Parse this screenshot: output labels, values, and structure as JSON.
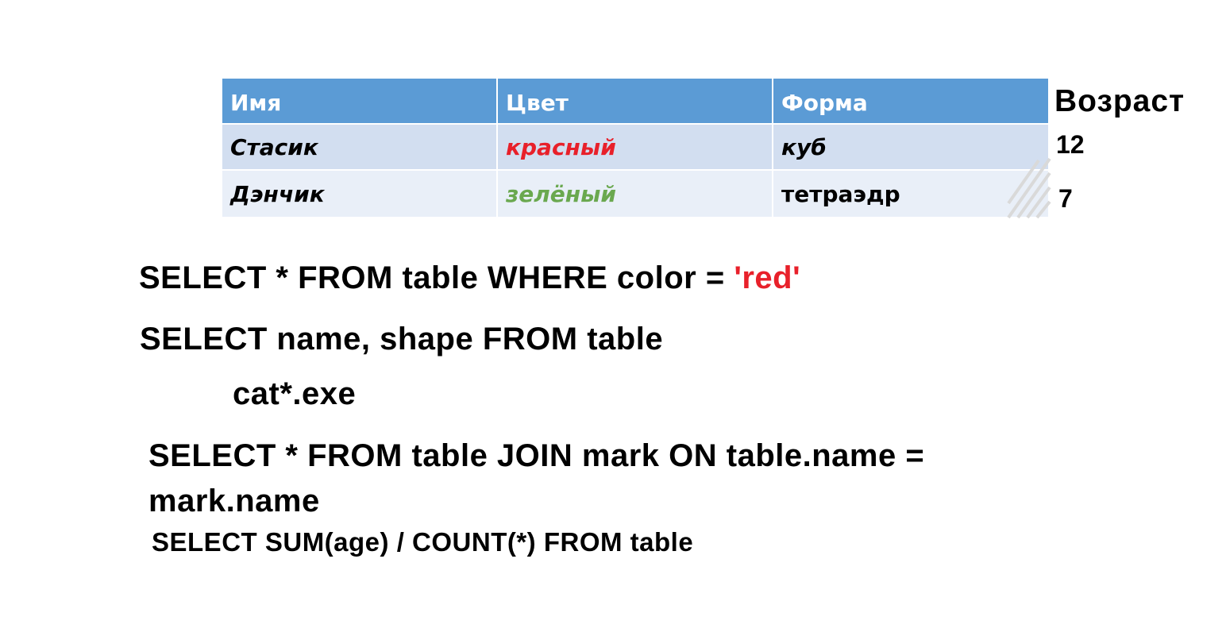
{
  "table": {
    "headers": [
      "Имя",
      "Цвет",
      "Форма"
    ],
    "rows": [
      {
        "name": "Стасик",
        "color": "красный",
        "shape": "куб"
      },
      {
        "name": "Дэнчик",
        "color": "зелёный",
        "shape": "тетраэдр"
      }
    ],
    "extra_column": {
      "header": "Возраст",
      "values": [
        "12",
        "7"
      ]
    }
  },
  "colors": {
    "header_bg": "#5b9bd5",
    "row1_bg": "#d2def0",
    "row2_bg": "#e9eff8",
    "red": "#e8202a",
    "green": "#6aa84f"
  },
  "queries": {
    "q1_main": "SELECT * FROM table WHERE color = ",
    "q1_value": "'red'",
    "q2": "SELECT name, shape FROM table",
    "q3": "cat*.exe",
    "q4": "SELECT * FROM table JOIN mark ON table.name = mark.name",
    "q5": "SELECT SUM(age) / COUNT(*) FROM table"
  }
}
